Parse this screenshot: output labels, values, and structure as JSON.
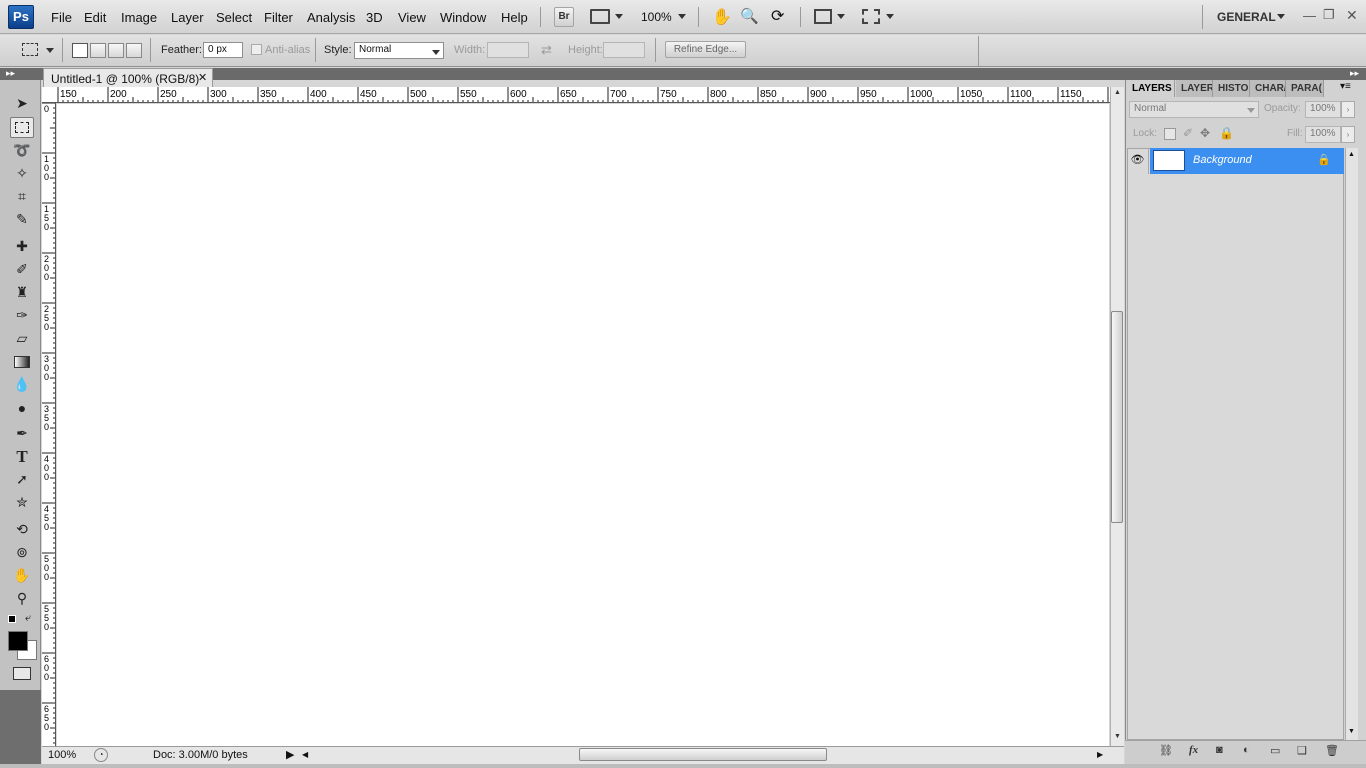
{
  "app": {
    "logo": "Ps",
    "workspace": "GENERAL"
  },
  "menu": [
    "File",
    "Edit",
    "Image",
    "Layer",
    "Select",
    "Filter",
    "Analysis",
    "3D",
    "View",
    "Window",
    "Help"
  ],
  "appbar": {
    "bridge_label": "Br",
    "zoom": "100%"
  },
  "options": {
    "feather_label": "Feather:",
    "feather_value": "0 px",
    "antialias_label": "Anti-alias",
    "style_label": "Style:",
    "style_value": "Normal",
    "width_label": "Width:",
    "height_label": "Height:",
    "refine_edge": "Refine Edge..."
  },
  "document": {
    "tab_title": "Untitled-1 @ 100% (RGB/8)",
    "zoom": "100%",
    "doc_info": "Doc: 3.00M/0 bytes"
  },
  "ruler": {
    "h_ticks": [
      "150",
      "200",
      "250",
      "300",
      "350",
      "400",
      "450",
      "500",
      "550",
      "600",
      "650",
      "700",
      "750",
      "800",
      "850",
      "900",
      "950",
      "1000",
      "1050",
      "1100",
      "1150",
      "12"
    ],
    "v_ticks": [
      "0",
      "100",
      "150",
      "200",
      "250",
      "300",
      "350",
      "400",
      "450",
      "500",
      "550",
      "600",
      "650",
      "7"
    ]
  },
  "panel": {
    "tabs": [
      "LAYERS",
      "LAYER",
      "HISTO",
      "CHAR/",
      "PARA("
    ],
    "blend_mode": "Normal",
    "opacity_label": "Opacity:",
    "opacity_value": "100%",
    "lock_label": "Lock:",
    "fill_label": "Fill:",
    "fill_value": "100%",
    "layer_name": "Background"
  },
  "colors": {
    "accent": "#3b8ff0",
    "logo_bg": "#1a5aa8"
  }
}
